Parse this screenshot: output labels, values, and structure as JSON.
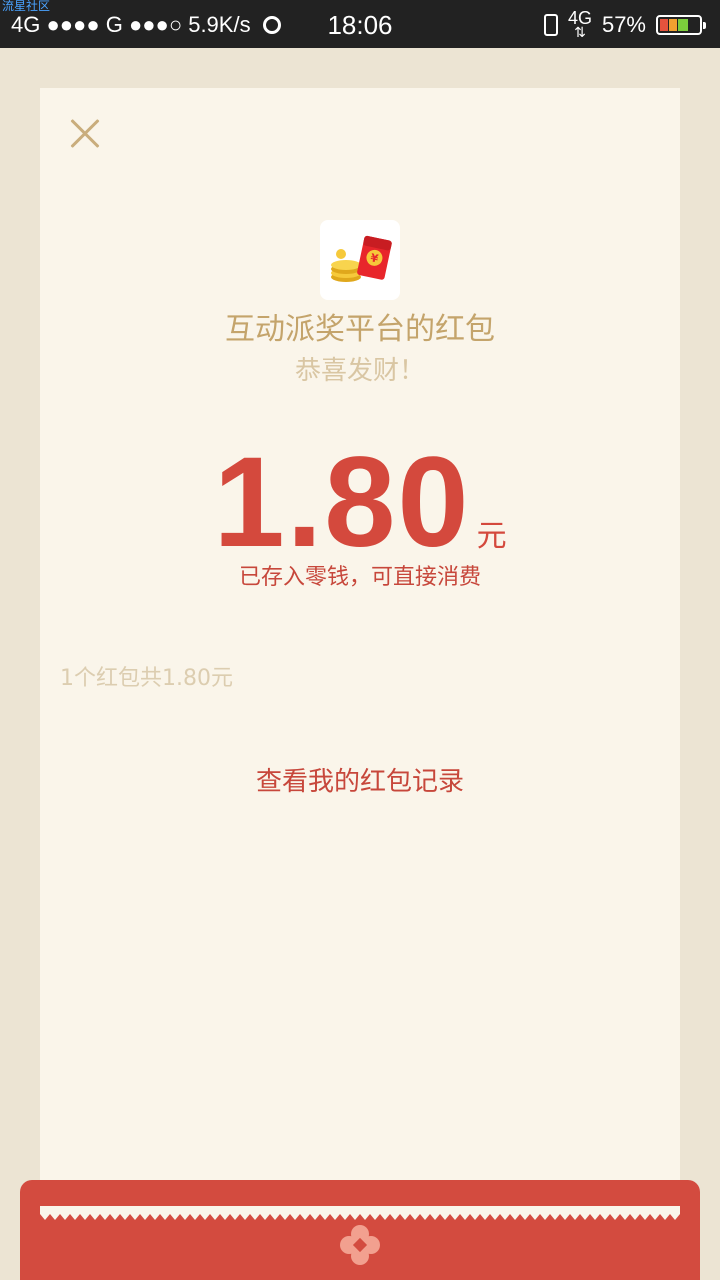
{
  "status_bar": {
    "tag": "流星社区",
    "left": "4G ●●●● G ●●●○ 5.9K/s",
    "time": "18:06",
    "network": "4G",
    "battery": "57%"
  },
  "packet": {
    "sender": "互动派奖平台的红包",
    "greeting": "恭喜发财！",
    "amount": "1.80",
    "unit": "元",
    "deposit_note": "已存入零钱，可直接消费",
    "summary": "1个红包共1.80元",
    "records_link": "查看我的红包记录"
  },
  "colors": {
    "accent_red": "#d4493d",
    "gold_text": "#c4a46b",
    "card_bg": "#faf5ea",
    "page_bg": "#ece4d3"
  },
  "icons": [
    "close-icon",
    "wifi-icon",
    "vibrate-icon",
    "battery-icon",
    "red-packet-icon",
    "flower-icon"
  ]
}
